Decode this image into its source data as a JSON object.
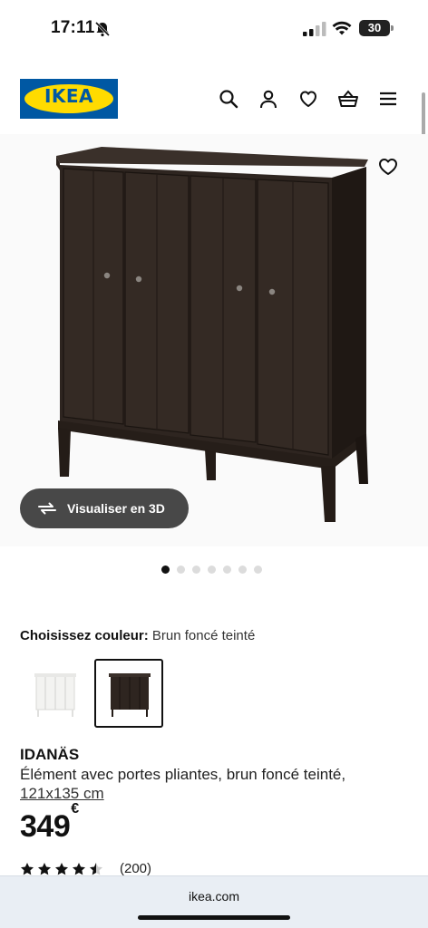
{
  "status": {
    "time": "17:11",
    "battery": "30"
  },
  "header": {
    "logo_text": "IKEA",
    "icons": [
      "search-icon",
      "account-icon",
      "wishlist-heart-icon",
      "shopping-basket-icon",
      "menu-icon"
    ]
  },
  "gallery": {
    "visualize_label": "Visualiser en 3D",
    "dot_count": 7,
    "active_dot": 0
  },
  "color": {
    "label": "Choisissez couleur:",
    "value": "Brun foncé teinté",
    "options": [
      "white",
      "dark-brown"
    ],
    "selected": "dark-brown"
  },
  "product": {
    "name": "IDANÄS",
    "description": "Élément avec portes pliantes, brun foncé teinté,",
    "dimensions": "121x135 cm",
    "price": "349",
    "currency": "€",
    "rating": 4.5,
    "review_count": "(200)"
  },
  "browser": {
    "url": "ikea.com"
  },
  "colors": {
    "brand_blue": "#0058a3",
    "brand_yellow": "#ffdb00",
    "cabinet_brown": "#2e2520"
  }
}
